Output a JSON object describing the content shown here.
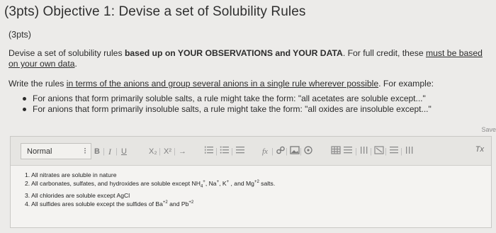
{
  "header": {
    "title": "(3pts) Objective 1: Devise a set of Solubility Rules"
  },
  "question": {
    "points": "(3pts)",
    "intro": {
      "part1": "Devise a set of solubility rules ",
      "bold": "based up on YOUR OBSERVATIONS and YOUR DATA",
      "part2": ". For full credit, these ",
      "underline": "must be based on your own data",
      "end": "."
    },
    "instruction": {
      "prefix": "Write the rules ",
      "underline": "in terms of the anions and group several anions in a single rule wherever possible",
      "suffix": ". For example:"
    },
    "examples": [
      "For anions that form primarily soluble salts, a rule might take the form: \"all acetates are soluble except...\"",
      "For anions that form primarily insoluble salts, a rule might take the form: \"all oxides are insoluble except...\""
    ]
  },
  "editor": {
    "save_label": "Save",
    "style_value": "Normal",
    "toolbar": {
      "bold": "B",
      "italic": "I",
      "underline": "U",
      "subscript": "X₂",
      "superscript": "X²",
      "arrow": "→",
      "function": "fx",
      "clear": "Tx"
    },
    "rules": [
      {
        "n": "1.",
        "text": "All nitrates are soluble in nature"
      },
      {
        "n": "2.",
        "pre": "All carbonates, sulfates, and hydroxides are soluble except NH",
        "sub": "4",
        "sup1": "+",
        "mid1": ", Na",
        "sup2": "+",
        "mid2": ", K",
        "sup3": "+",
        "mid3": " , and Mg",
        "sup4": "+2",
        "post": " salts."
      },
      {
        "n": "3.",
        "text": "All chlorides are soluble except AgCl"
      },
      {
        "n": "4.",
        "pre": "All sulfides ares soluble except the sulfides of Ba",
        "sup1": "+2",
        "mid1": " and Pb",
        "sup2": "+2"
      }
    ]
  }
}
